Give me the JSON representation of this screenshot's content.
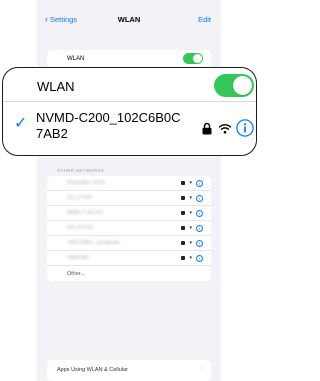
{
  "nav": {
    "back_label": "Settings",
    "title": "WLAN",
    "edit_label": "Edit"
  },
  "wlan_row": {
    "label": "WLAN",
    "toggle_on": true
  },
  "callout": {
    "wlan_label": "WLAN",
    "connected_network": "NVMD-C200_102C6B0C7AB2",
    "check": "✓",
    "info": "i"
  },
  "other_networks": {
    "section_label": "OTHER NETWORKS",
    "items": [
      {
        "name": "DimaSkin-DGO"
      },
      {
        "name": "CU_FTHP"
      },
      {
        "name": "BBBCT-5G-HT"
      },
      {
        "name": "HG-C3-5G"
      },
      {
        "name": "TAICOMIC_Unutunile"
      },
      {
        "name": "2ABFMO"
      }
    ],
    "other_label": "Other..."
  },
  "bottom": {
    "label": "Apps Using WLAN & Cellular",
    "chevron": "›"
  },
  "colors": {
    "accent": "#0a7aff",
    "toggle_green": "#34c759",
    "background": "#f2f2f7"
  }
}
